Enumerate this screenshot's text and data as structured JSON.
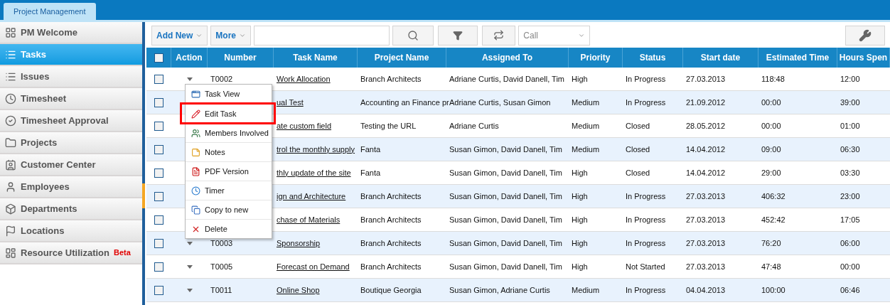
{
  "app_tab": {
    "label": "Project Management",
    "selected": true
  },
  "sidebar": {
    "items": [
      {
        "label": "PM Welcome",
        "selected": false
      },
      {
        "label": "Tasks",
        "selected": true
      },
      {
        "label": "Issues",
        "selected": false
      },
      {
        "label": "Timesheet",
        "selected": false
      },
      {
        "label": "Timesheet Approval",
        "selected": false
      },
      {
        "label": "Projects",
        "selected": false
      },
      {
        "label": "Customer Center",
        "selected": false
      },
      {
        "label": "Employees",
        "selected": false
      },
      {
        "label": "Departments",
        "selected": false
      },
      {
        "label": "Locations",
        "selected": false
      },
      {
        "label": "Resource Utilization",
        "selected": false,
        "badge": "Beta"
      }
    ]
  },
  "toolbar": {
    "add_new": "Add New",
    "more": "More",
    "filter_select": "Call"
  },
  "table": {
    "select_all": {
      "checked": false
    },
    "columns": [
      "Action",
      "Number",
      "Task Name",
      "Project Name",
      "Assigned To",
      "Priority",
      "Status",
      "Start date",
      "Estimated Time",
      "Hours Spen"
    ],
    "rows": [
      {
        "checked": false,
        "number": "T0002",
        "task": "Work Allocation",
        "project": "Branch Architects",
        "assigned": "Adriane Curtis, David Danell, Tim",
        "priority": "High",
        "status": "In Progress",
        "start": "27.03.2013",
        "estimated": "118:48",
        "hours": "12:00"
      },
      {
        "checked": false,
        "task": "ual Test",
        "project": "Accounting an Finance pr",
        "assigned": "Adriane Curtis, Susan Gimon",
        "priority": "Medium",
        "status": "In Progress",
        "start": "21.09.2012",
        "estimated": "00:00",
        "hours": "39:00"
      },
      {
        "checked": false,
        "task": "ate custom field",
        "project": "Testing the URL",
        "assigned": "Adriane Curtis",
        "priority": "Medium",
        "status": "Closed",
        "start": "28.05.2012",
        "estimated": "00:00",
        "hours": "01:00"
      },
      {
        "checked": false,
        "task": "trol the monthly supply",
        "project": "Fanta",
        "assigned": "Susan Gimon, David Danell, Tim",
        "priority": "Medium",
        "status": "Closed",
        "start": "14.04.2012",
        "estimated": "09:00",
        "hours": "06:30"
      },
      {
        "checked": false,
        "task": "thly update of the site",
        "project": "Fanta",
        "assigned": "Susan Gimon, David Danell, Tim",
        "priority": "High",
        "status": "Closed",
        "start": "14.04.2012",
        "estimated": "29:00",
        "hours": "03:30"
      },
      {
        "checked": false,
        "task": "ign and Architecture",
        "project": "Branch Architects",
        "assigned": "Susan Gimon, David Danell, Tim",
        "priority": "High",
        "status": "In Progress",
        "start": "27.03.2013",
        "estimated": "406:32",
        "hours": "23:00"
      },
      {
        "checked": false,
        "task": "chase of Materials",
        "project": "Branch Architects",
        "assigned": "Susan Gimon, David Danell, Tim",
        "priority": "High",
        "status": "In Progress",
        "start": "27.03.2013",
        "estimated": "452:42",
        "hours": "17:05"
      },
      {
        "checked": false,
        "number": "T0003",
        "task": "Sponsorship",
        "project": "Branch Architects",
        "assigned": "Susan Gimon, David Danell, Tim",
        "priority": "High",
        "status": "In Progress",
        "start": "27.03.2013",
        "estimated": "76:20",
        "hours": "06:00"
      },
      {
        "checked": false,
        "number": "T0005",
        "task": "Forecast on Demand",
        "project": "Branch Architects",
        "assigned": "Susan Gimon, David Danell, Tim",
        "priority": "High",
        "status": "Not Started",
        "start": "27.03.2013",
        "estimated": "47:48",
        "hours": "00:00"
      },
      {
        "checked": false,
        "number": "T0011",
        "task": "Online Shop",
        "project": "Boutique Georgia",
        "assigned": "Susan Gimon, Adriane Curtis",
        "priority": "Medium",
        "status": "In Progress",
        "start": "04.04.2013",
        "estimated": "100:00",
        "hours": "06:46"
      }
    ]
  },
  "context_menu": {
    "items": [
      {
        "label": "Task View",
        "highlighted": false
      },
      {
        "label": "Edit Task",
        "highlighted": true
      },
      {
        "label": "Members Involved",
        "highlighted": false
      },
      {
        "label": "Notes",
        "highlighted": false
      },
      {
        "label": "PDF Version",
        "highlighted": false
      },
      {
        "label": "Timer",
        "highlighted": false
      },
      {
        "label": "Copy to new",
        "highlighted": false
      },
      {
        "label": "Delete",
        "highlighted": false
      }
    ]
  }
}
